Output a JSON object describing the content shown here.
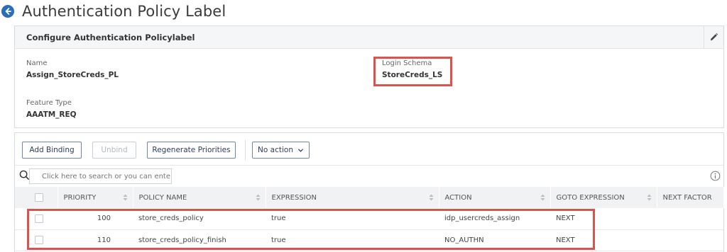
{
  "header": {
    "title": "Authentication Policy Label"
  },
  "config": {
    "title": "Configure Authentication Policylabel",
    "name_label": "Name",
    "name_value": "Assign_StoreCreds_PL",
    "feature_label": "Feature Type",
    "feature_value": "AAATM_REQ",
    "schema_label": "Login Schema",
    "schema_value": "StoreCreds_LS"
  },
  "toolbar": {
    "add_binding": "Add Binding",
    "unbind": "Unbind",
    "regenerate": "Regenerate Priorities",
    "no_action": "No action"
  },
  "search": {
    "placeholder": "Click here to search or you can ente"
  },
  "table": {
    "columns": [
      "PRIORITY",
      "POLICY NAME",
      "EXPRESSION",
      "ACTION",
      "GOTO EXPRESSION",
      "NEXT FACTOR"
    ],
    "rows": [
      {
        "priority": "100",
        "policy": "store_creds_policy",
        "expression": "true",
        "action": "idp_usercreds_assign",
        "goto": "NEXT",
        "next_factor": ""
      },
      {
        "priority": "110",
        "policy": "store_creds_policy_finish",
        "expression": "true",
        "action": "NO_AUTHN",
        "goto": "NEXT",
        "next_factor": ""
      }
    ]
  },
  "colors": {
    "accent": "#2a6ebb",
    "highlight": "#d9534f",
    "header_bg": "#f5f6f7"
  },
  "icons": {
    "back": "back-arrow-icon",
    "edit": "pencil-icon",
    "search": "search-icon",
    "info": "info-icon",
    "sort": "sort-icon",
    "dropdown": "chevron-down-icon"
  }
}
